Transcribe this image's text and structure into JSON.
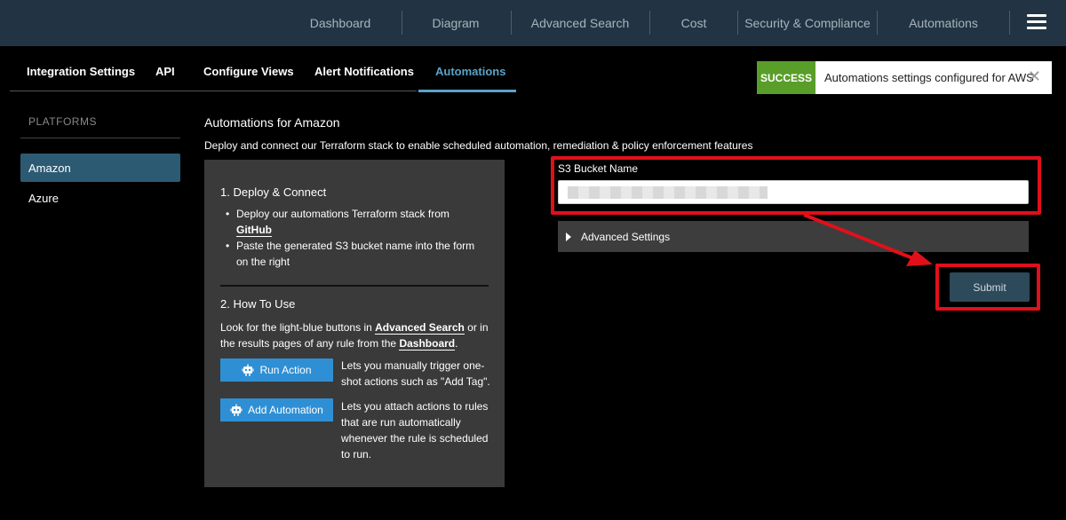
{
  "nav": {
    "items": [
      "Dashboard",
      "Diagram",
      "Advanced Search",
      "Cost",
      "Security & Compliance",
      "Automations"
    ],
    "menu_icon": "hamburger-menu-icon"
  },
  "tabs": {
    "items": [
      "Integration Settings",
      "API",
      "Configure Views",
      "Alert Notifications",
      "Automations"
    ],
    "active": "Automations"
  },
  "toast": {
    "status": "SUCCESS",
    "message": "Automations settings configured for AWS",
    "close": "✕"
  },
  "sidebar": {
    "heading": "PLATFORMS",
    "items": [
      "Amazon",
      "Azure"
    ],
    "active": "Amazon"
  },
  "main": {
    "title": "Automations for Amazon",
    "description": "Deploy and connect our Terraform stack to enable scheduled automation, remediation & policy enforcement features"
  },
  "panel": {
    "section1_title": "1. Deploy & Connect",
    "bullet1_text": "Deploy our automations Terraform stack from ",
    "bullet1_link": "GitHub",
    "bullet2_text": "Paste the generated S3 bucket name into the form on the right",
    "section2_title": "2. How To Use",
    "how_text_1": "Look for the light-blue buttons in ",
    "how_link_1": "Advanced Search",
    "how_text_2": " or in the results pages of any rule from the ",
    "how_link_2": "Dashboard",
    "how_text_3": ".",
    "run_action_label": "Run Action",
    "run_action_desc": "Lets you manually trigger one-shot actions such as \"Add Tag\".",
    "add_automation_label": "Add Automation",
    "add_automation_desc": "Lets you attach actions to rules that are run automatically whenever the rule is scheduled to run."
  },
  "form": {
    "s3_label": "S3 Bucket Name",
    "advanced_label": "Advanced Settings",
    "submit_label": "Submit"
  },
  "colors": {
    "topbar": "#223443",
    "accent": "#5aa3c8",
    "success": "#5a9e2a",
    "action_button": "#2f8fd4",
    "annotation": "#e0101a"
  }
}
